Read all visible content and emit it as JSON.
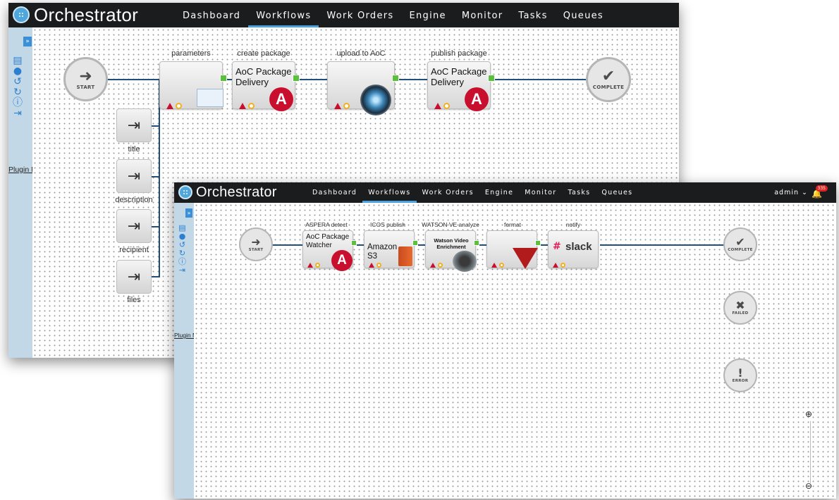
{
  "app": {
    "title": "Orchestrator",
    "accent": "#4aa3df",
    "topbar_color": "#1b1c1e",
    "sidebar_color": "#c3d8e6"
  },
  "nav": [
    {
      "label": "Dashboard"
    },
    {
      "label": "Workflows",
      "active": true
    },
    {
      "label": "Work Orders"
    },
    {
      "label": "Engine"
    },
    {
      "label": "Monitor"
    },
    {
      "label": "Tasks"
    },
    {
      "label": "Queues"
    }
  ],
  "user": {
    "name": "admin",
    "notifications": "335"
  },
  "sidebar": {
    "toggle": "»",
    "plugin_label": "Plugin Manag",
    "icons": [
      "document-list-icon",
      "play-icon",
      "undo-icon",
      "redo-icon",
      "info-icon",
      "exit-icon"
    ]
  },
  "workflow_back": {
    "start": "START",
    "complete": "COMPLETE",
    "nodes": [
      {
        "label": "parameters",
        "title": "",
        "icon": "form-icon"
      },
      {
        "label": "create package",
        "title": "AoC Package Delivery",
        "icon": "aspera-icon"
      },
      {
        "label": "upload to AoC",
        "title": "",
        "icon": "lens-icon"
      },
      {
        "label": "publish package",
        "title": "AoC Package Delivery",
        "icon": "aspera-icon"
      }
    ],
    "inputs": [
      {
        "label": "title"
      },
      {
        "label": "description"
      },
      {
        "label": "recipient"
      },
      {
        "label": "files"
      }
    ]
  },
  "workflow_front": {
    "start": "START",
    "complete": "COMPLETE",
    "failed": "FAILED",
    "error": "ERROR",
    "nodes": [
      {
        "label": "ASPERA detect",
        "title": "AoC Package Watcher",
        "icon": "aspera-icon"
      },
      {
        "label": "ICOS publish",
        "title": "Amazon S3",
        "icon": "s3-icon"
      },
      {
        "label": "WATSON VE analyze",
        "title": "Watson Video Enrichment",
        "icon": "watson-icon"
      },
      {
        "label": "format",
        "title": "",
        "icon": "ruby-icon"
      },
      {
        "label": "notify",
        "title": "slack",
        "icon": "slack-icon"
      }
    ]
  }
}
